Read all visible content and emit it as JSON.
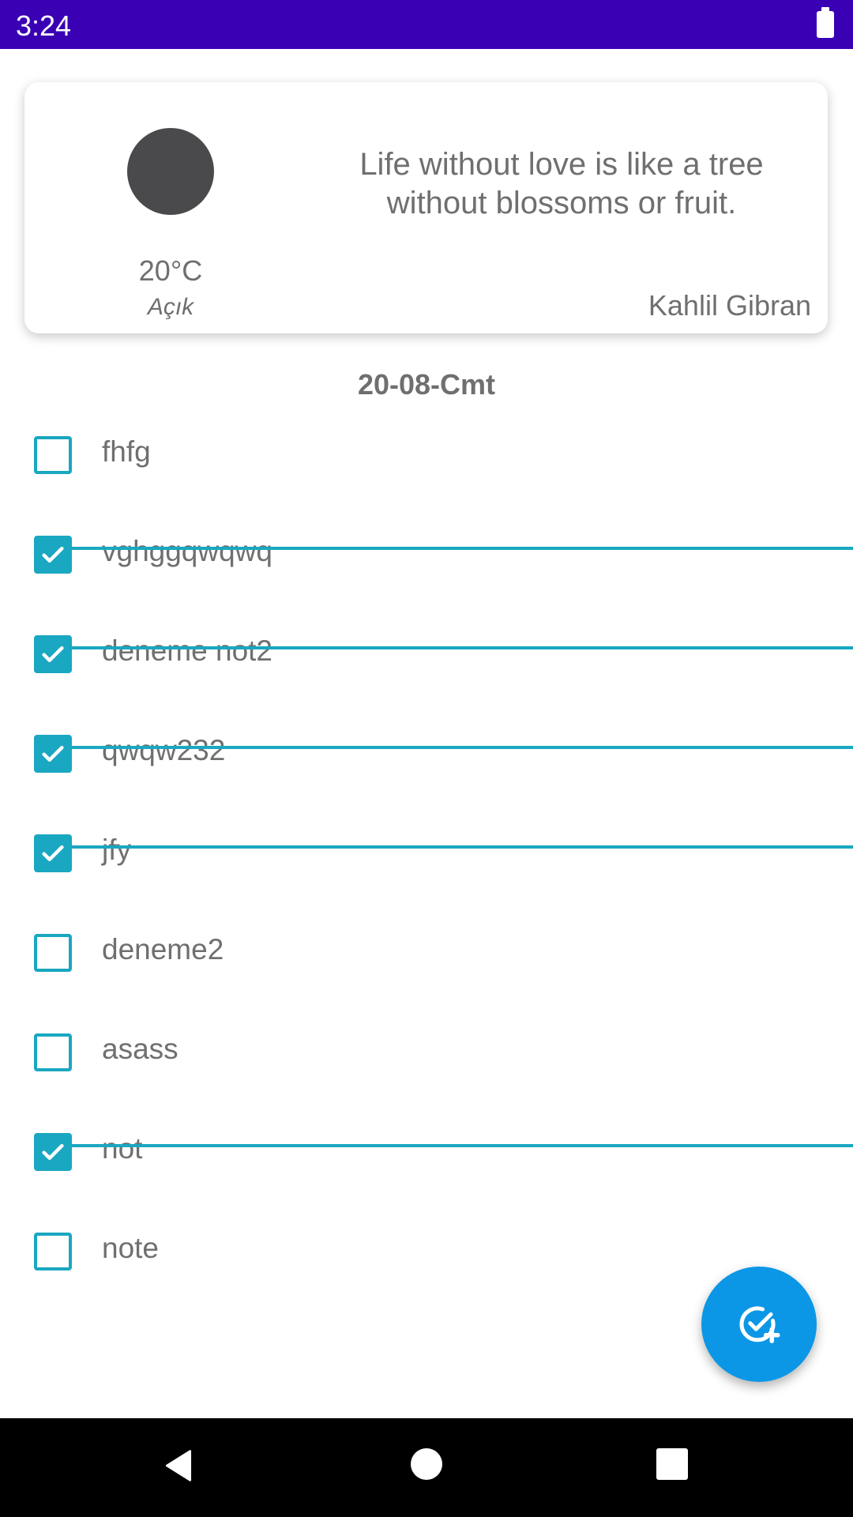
{
  "status_bar": {
    "time": "3:24"
  },
  "weather": {
    "temperature": "20°C",
    "condition": "Açık",
    "icon": "weather-icon"
  },
  "quote": {
    "text": "Life without love is like a tree without blossoms or fruit.",
    "author": "Kahlil Gibran"
  },
  "date": "20-08-Cmt",
  "todos": [
    {
      "text": "fhfg",
      "done": false
    },
    {
      "text": " vghggqwqwq",
      "done": true
    },
    {
      "text": "deneme not2",
      "done": true
    },
    {
      "text": "qwqw232",
      "done": true
    },
    {
      "text": "jfy",
      "done": true
    },
    {
      "text": "deneme2",
      "done": false
    },
    {
      "text": "asass",
      "done": false
    },
    {
      "text": "not",
      "done": true
    },
    {
      "text": "note",
      "done": false
    }
  ],
  "fab": {
    "icon": "add-task-icon"
  },
  "colors": {
    "status_bar": "#3a00b3",
    "accent": "#1aa7c1",
    "fab": "#0b97e6"
  }
}
